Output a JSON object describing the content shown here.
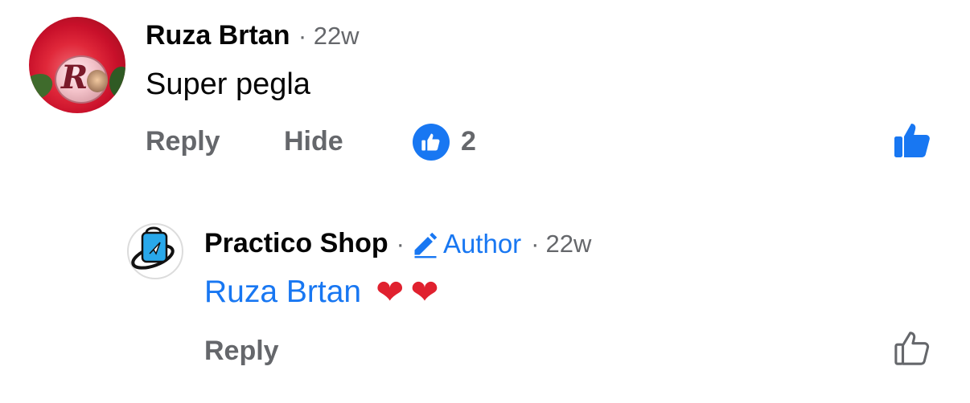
{
  "comment": {
    "author": "Ruza Brtan",
    "separator": "·",
    "time": "22w",
    "text": "Super pegla",
    "actions": {
      "reply": "Reply",
      "hide": "Hide"
    },
    "reaction_count": "2",
    "reaction_icon": "like-icon",
    "avatar_monogram": "R"
  },
  "reply": {
    "author": "Practico Shop",
    "separator": "·",
    "author_badge": "Author",
    "separator2": "·",
    "time": "22w",
    "mention": "Ruza Brtan",
    "hearts": [
      "❤",
      "❤"
    ],
    "actions": {
      "reply": "Reply"
    }
  },
  "colors": {
    "accent": "#1877f2",
    "secondary_text": "#65676b",
    "primary_text": "#050505",
    "heart": "#e0212f"
  }
}
